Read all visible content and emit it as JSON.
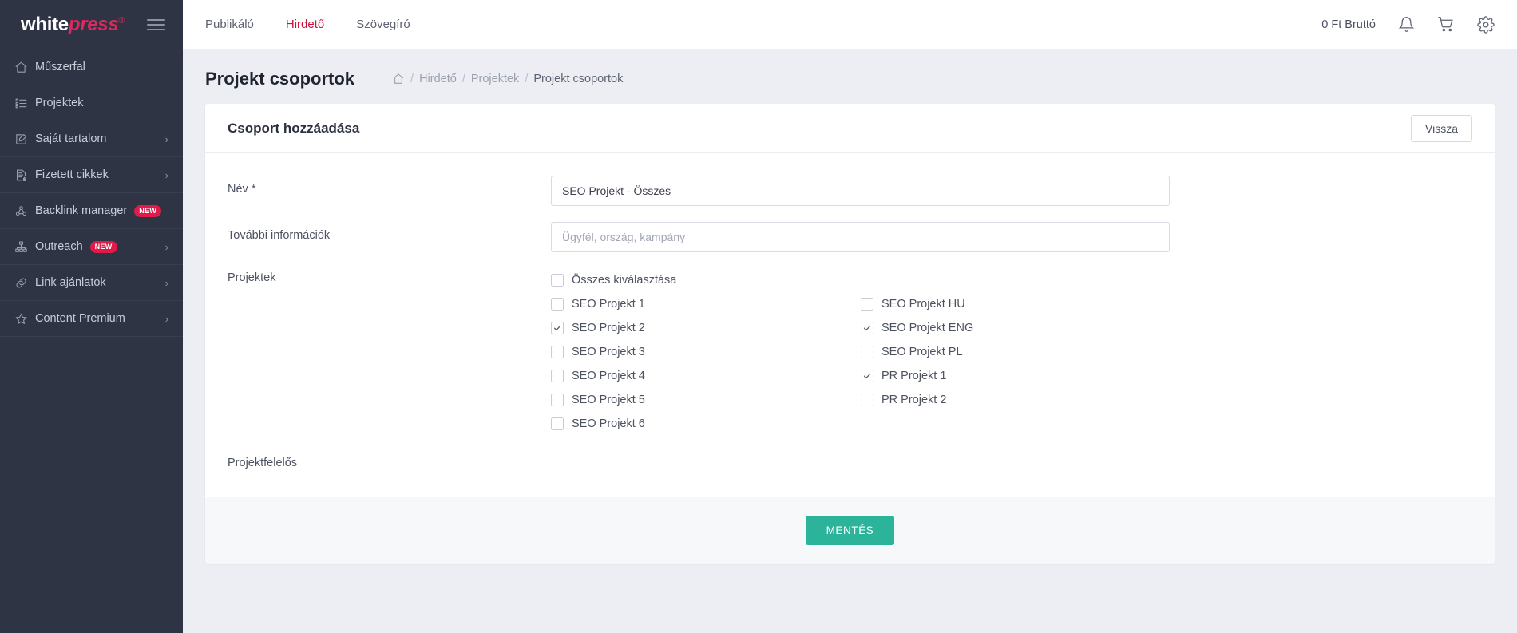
{
  "brand": {
    "logo_white": "white",
    "logo_press": "press",
    "logo_mark": "®"
  },
  "colors": {
    "sidebar_bg": "#2f3445",
    "accent_pink": "#e1275b",
    "active_nav": "#d0103a",
    "badge_new": "#e01b4c",
    "save_button": "#2cb49a",
    "page_bg": "#eceef4"
  },
  "sidebar": {
    "items": [
      {
        "label": "Műszerfal",
        "icon": "home-icon",
        "badge": "",
        "chevron": false
      },
      {
        "label": "Projektek",
        "icon": "list-icon",
        "badge": "",
        "chevron": false
      },
      {
        "label": "Saját tartalom",
        "icon": "edit-square-icon",
        "badge": "",
        "chevron": true
      },
      {
        "label": "Fizetett cikkek",
        "icon": "document-dollar-icon",
        "badge": "",
        "chevron": true
      },
      {
        "label": "Backlink manager",
        "icon": "backlink-icon",
        "badge": "NEW",
        "chevron": false
      },
      {
        "label": "Outreach",
        "icon": "sitemap-icon",
        "badge": "NEW",
        "chevron": true
      },
      {
        "label": "Link ajánlatok",
        "icon": "link-icon",
        "badge": "",
        "chevron": true
      },
      {
        "label": "Content Premium",
        "icon": "star-icon",
        "badge": "",
        "chevron": true
      }
    ],
    "chevron_glyph": "›",
    "hamburger_icon": "hamburger-icon"
  },
  "topbar": {
    "nav": [
      {
        "label": "Publikáló",
        "active": false
      },
      {
        "label": "Hirdető",
        "active": true
      },
      {
        "label": "Szövegíró",
        "active": false
      }
    ],
    "balance": "0 Ft Bruttó",
    "icons": [
      "bell-icon",
      "cart-icon",
      "gear-icon"
    ]
  },
  "page": {
    "title": "Projekt csoportok",
    "breadcrumb": {
      "home_icon": "home-icon",
      "items": [
        "Hirdető",
        "Projektek",
        "Projekt csoportok"
      ],
      "separator": "/"
    }
  },
  "card": {
    "title": "Csoport hozzáadása",
    "back_button": "Vissza",
    "save_button": "MENTÉS",
    "fields": {
      "name": {
        "label": "Név *",
        "value": "SEO Projekt - Összes",
        "placeholder": ""
      },
      "info": {
        "label": "További információk",
        "value": "",
        "placeholder": "Ügyfél, ország, kampány"
      },
      "projects_label": "Projektek",
      "owner_label": "Projektfelelős"
    },
    "select_all": {
      "label": "Összes kiválasztása",
      "checked": false
    },
    "project_rows": [
      {
        "left": {
          "label": "SEO Projekt 1",
          "checked": false
        },
        "right": {
          "label": "SEO Projekt HU",
          "checked": false
        }
      },
      {
        "left": {
          "label": "SEO Projekt 2",
          "checked": true
        },
        "right": {
          "label": "SEO Projekt ENG",
          "checked": true
        }
      },
      {
        "left": {
          "label": "SEO Projekt 3",
          "checked": false
        },
        "right": {
          "label": "SEO Projekt PL",
          "checked": false
        }
      },
      {
        "left": {
          "label": "SEO Projekt 4",
          "checked": false
        },
        "right": {
          "label": "PR Projekt 1",
          "checked": true
        }
      },
      {
        "left": {
          "label": "SEO Projekt 5",
          "checked": false
        },
        "right": {
          "label": "PR Projekt 2",
          "checked": false
        }
      },
      {
        "left": {
          "label": "SEO Projekt 6",
          "checked": false
        },
        "right": null
      }
    ]
  }
}
